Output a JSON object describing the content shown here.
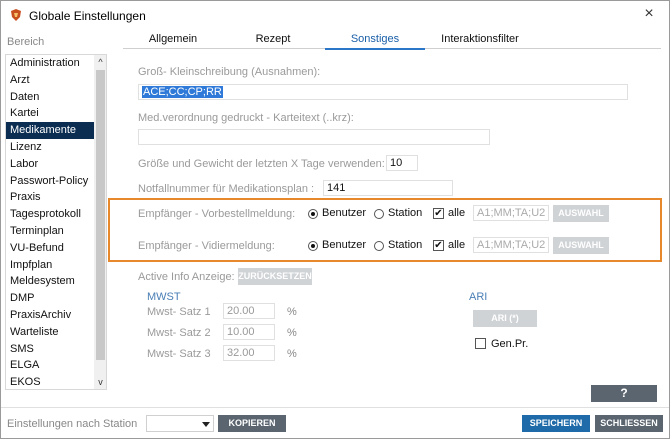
{
  "window": {
    "title": "Globale Einstellungen"
  },
  "sidebar": {
    "header": "Bereich",
    "items": [
      "Administration",
      "Arzt",
      "Daten",
      "Kartei",
      "Medikamente",
      "Lizenz",
      "Labor",
      "Passwort-Policy",
      "Praxis",
      "Tagesprotokoll",
      "Terminplan",
      "VU-Befund",
      "Impfplan",
      "Meldesystem",
      "DMP",
      "PraxisArchiv",
      "Warteliste",
      "SMS",
      "ELGA",
      "EKOS"
    ],
    "active_index": 4
  },
  "tabs": [
    "Allgemein",
    "Rezept",
    "Sonstiges",
    "Interaktionsfilter"
  ],
  "active_tab": "Sonstiges",
  "form": {
    "gross_label": "Groß- Kleinschreibung (Ausnahmen):",
    "gross_value": "ACE;CC;CP;RR",
    "med_label": "Med.verordnung gedruckt - Karteitext (..krz):",
    "med_value": "",
    "groesse_label": "Größe und Gewicht der letzten X Tage verwenden:",
    "groesse_value": "10",
    "notfall_label": "Notfallnummer für Medikationsplan :",
    "notfall_value": "141"
  },
  "empfaenger": [
    {
      "label": "Empfänger - Vorbestellmeldung:",
      "benutzer": "Benutzer",
      "station": "Station",
      "alle": "alle",
      "checkmark": "✔",
      "selected": "benutzer",
      "stations": "A1;MM;TA;U2",
      "button": "AUSWAHL"
    },
    {
      "label": "Empfänger - Vidiermeldung:",
      "benutzer": "Benutzer",
      "station": "Station",
      "alle": "alle",
      "checkmark": "✔",
      "selected": "benutzer",
      "stations": "A1;MM;TA;U2",
      "button": "AUSWAHL"
    }
  ],
  "active_info": {
    "label": "Active Info Anzeige:",
    "button": "ZURÜCKSETZEN"
  },
  "mwst": {
    "title": "MWST",
    "rows": [
      {
        "label": "Mwst- Satz 1",
        "value": "20.00",
        "unit": "%"
      },
      {
        "label": "Mwst- Satz 2",
        "value": "10.00",
        "unit": "%"
      },
      {
        "label": "Mwst- Satz 3",
        "value": "32.00",
        "unit": "%"
      }
    ]
  },
  "ari": {
    "title": "ARI",
    "button": "ARI (*)",
    "checkbox_label": "Gen.Pr."
  },
  "footer": {
    "station_label": "Einstellungen nach Station",
    "copy_button": "KOPIEREN",
    "save_button": "SPEICHERN",
    "close_button": "SCHLIESSEN",
    "help_button": "?"
  },
  "icons": {
    "close": "×",
    "scroll_up": "^",
    "scroll_down": "v"
  }
}
